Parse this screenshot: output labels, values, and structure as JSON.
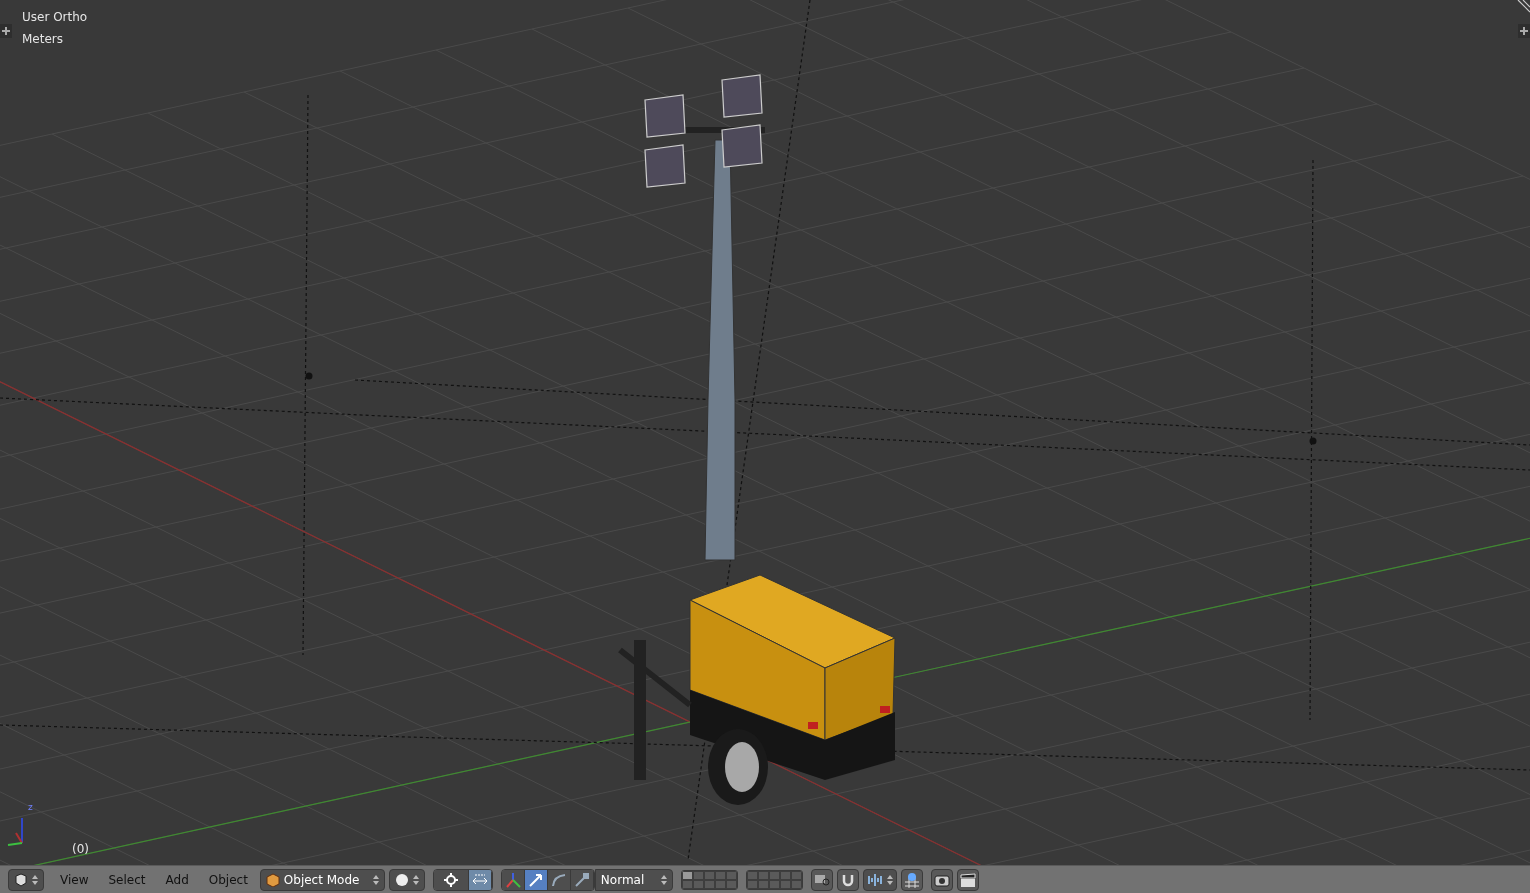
{
  "viewport": {
    "view_name": "User Ortho",
    "units": "Meters",
    "frame": "(0)",
    "axis_label": "z"
  },
  "header": {
    "menus": [
      "View",
      "Select",
      "Add",
      "Object"
    ],
    "mode": "Object Mode",
    "manipulators": [
      {
        "kind": "translate",
        "selected": true
      },
      {
        "kind": "rotate",
        "selected": false
      },
      {
        "kind": "scale",
        "selected": false
      }
    ],
    "orientation": "Normal",
    "layers": [
      {
        "selected": true
      },
      {
        "selected": false
      },
      {
        "selected": false
      },
      {
        "selected": false
      },
      {
        "selected": false
      },
      {
        "selected": false
      },
      {
        "selected": false
      },
      {
        "selected": false
      },
      {
        "selected": false
      },
      {
        "selected": false
      },
      {
        "selected": false
      },
      {
        "selected": false
      },
      {
        "selected": false
      },
      {
        "selected": false
      },
      {
        "selected": false
      },
      {
        "selected": false
      },
      {
        "selected": false
      },
      {
        "selected": false
      },
      {
        "selected": false
      },
      {
        "selected": false
      }
    ]
  }
}
